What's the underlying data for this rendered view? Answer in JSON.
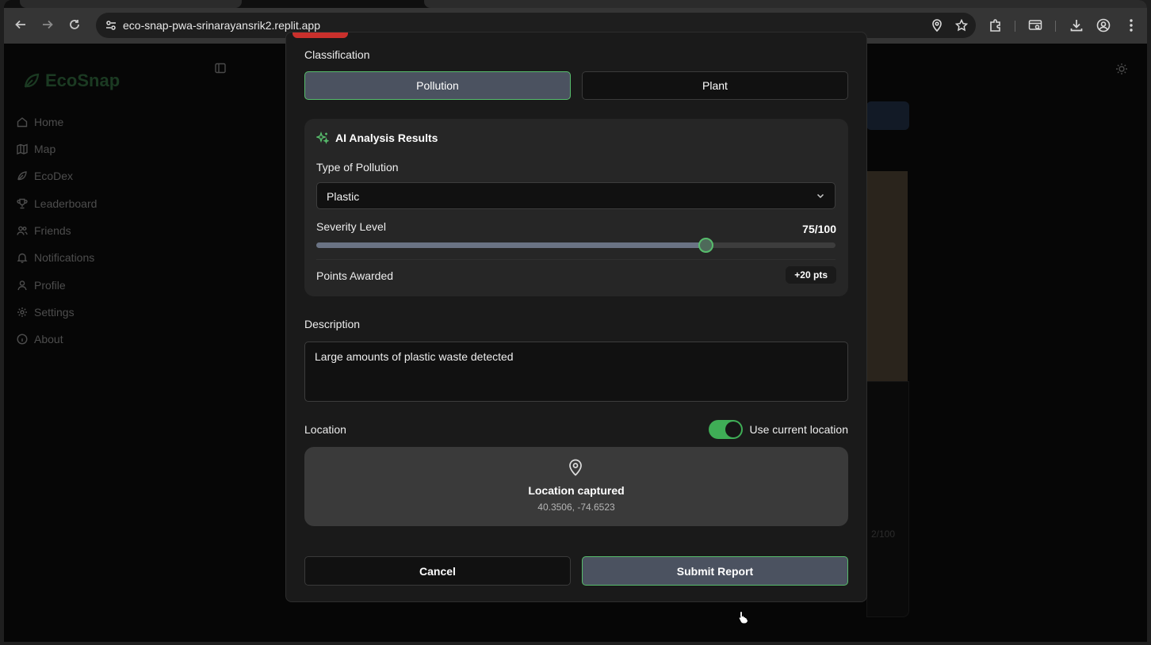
{
  "browser": {
    "url": "eco-snap-pwa-srinarayansrik2.replit.app"
  },
  "app": {
    "name": "EcoSnap",
    "sidebar": {
      "items": [
        {
          "label": "Home",
          "icon": "home-icon"
        },
        {
          "label": "Map",
          "icon": "map-icon"
        },
        {
          "label": "EcoDex",
          "icon": "leaf-icon"
        },
        {
          "label": "Leaderboard",
          "icon": "trophy-icon"
        },
        {
          "label": "Friends",
          "icon": "users-icon"
        },
        {
          "label": "Notifications",
          "icon": "bell-icon"
        },
        {
          "label": "Profile",
          "icon": "user-icon"
        },
        {
          "label": "Settings",
          "icon": "gear-icon"
        },
        {
          "label": "About",
          "icon": "info-icon"
        }
      ]
    },
    "background_text": "2/100"
  },
  "modal": {
    "classification_label": "Classification",
    "classification_options": [
      "Pollution",
      "Plant"
    ],
    "selected_classification": "Pollution",
    "ai_title": "AI Analysis Results",
    "pollution_type_label": "Type of Pollution",
    "pollution_type_value": "Plastic",
    "severity_label": "Severity Level",
    "severity_display": "75/100",
    "severity_value": 75,
    "severity_max": 100,
    "points_label": "Points Awarded",
    "points_value": "+20 pts",
    "description_label": "Description",
    "description_value": "Large amounts of plastic waste detected",
    "location_label": "Location",
    "use_current_location_label": "Use current location",
    "use_current_location_on": true,
    "location_status": "Location captured",
    "location_coords": "40.3506, -74.6523",
    "cancel_label": "Cancel",
    "submit_label": "Submit Report"
  },
  "colors": {
    "accent_green": "#57bd6c",
    "toggle_green": "#3fae56",
    "alert_red": "#c9302c"
  }
}
